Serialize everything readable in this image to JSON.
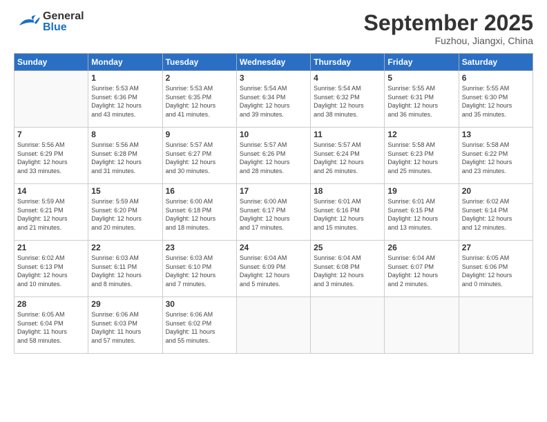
{
  "header": {
    "logo_general": "General",
    "logo_blue": "Blue",
    "month": "September 2025",
    "location": "Fuzhou, Jiangxi, China"
  },
  "weekdays": [
    "Sunday",
    "Monday",
    "Tuesday",
    "Wednesday",
    "Thursday",
    "Friday",
    "Saturday"
  ],
  "weeks": [
    [
      {
        "day": "",
        "info": ""
      },
      {
        "day": "1",
        "info": "Sunrise: 5:53 AM\nSunset: 6:36 PM\nDaylight: 12 hours\nand 43 minutes."
      },
      {
        "day": "2",
        "info": "Sunrise: 5:53 AM\nSunset: 6:35 PM\nDaylight: 12 hours\nand 41 minutes."
      },
      {
        "day": "3",
        "info": "Sunrise: 5:54 AM\nSunset: 6:34 PM\nDaylight: 12 hours\nand 39 minutes."
      },
      {
        "day": "4",
        "info": "Sunrise: 5:54 AM\nSunset: 6:32 PM\nDaylight: 12 hours\nand 38 minutes."
      },
      {
        "day": "5",
        "info": "Sunrise: 5:55 AM\nSunset: 6:31 PM\nDaylight: 12 hours\nand 36 minutes."
      },
      {
        "day": "6",
        "info": "Sunrise: 5:55 AM\nSunset: 6:30 PM\nDaylight: 12 hours\nand 35 minutes."
      }
    ],
    [
      {
        "day": "7",
        "info": "Sunrise: 5:56 AM\nSunset: 6:29 PM\nDaylight: 12 hours\nand 33 minutes."
      },
      {
        "day": "8",
        "info": "Sunrise: 5:56 AM\nSunset: 6:28 PM\nDaylight: 12 hours\nand 31 minutes."
      },
      {
        "day": "9",
        "info": "Sunrise: 5:57 AM\nSunset: 6:27 PM\nDaylight: 12 hours\nand 30 minutes."
      },
      {
        "day": "10",
        "info": "Sunrise: 5:57 AM\nSunset: 6:26 PM\nDaylight: 12 hours\nand 28 minutes."
      },
      {
        "day": "11",
        "info": "Sunrise: 5:57 AM\nSunset: 6:24 PM\nDaylight: 12 hours\nand 26 minutes."
      },
      {
        "day": "12",
        "info": "Sunrise: 5:58 AM\nSunset: 6:23 PM\nDaylight: 12 hours\nand 25 minutes."
      },
      {
        "day": "13",
        "info": "Sunrise: 5:58 AM\nSunset: 6:22 PM\nDaylight: 12 hours\nand 23 minutes."
      }
    ],
    [
      {
        "day": "14",
        "info": "Sunrise: 5:59 AM\nSunset: 6:21 PM\nDaylight: 12 hours\nand 21 minutes."
      },
      {
        "day": "15",
        "info": "Sunrise: 5:59 AM\nSunset: 6:20 PM\nDaylight: 12 hours\nand 20 minutes."
      },
      {
        "day": "16",
        "info": "Sunrise: 6:00 AM\nSunset: 6:18 PM\nDaylight: 12 hours\nand 18 minutes."
      },
      {
        "day": "17",
        "info": "Sunrise: 6:00 AM\nSunset: 6:17 PM\nDaylight: 12 hours\nand 17 minutes."
      },
      {
        "day": "18",
        "info": "Sunrise: 6:01 AM\nSunset: 6:16 PM\nDaylight: 12 hours\nand 15 minutes."
      },
      {
        "day": "19",
        "info": "Sunrise: 6:01 AM\nSunset: 6:15 PM\nDaylight: 12 hours\nand 13 minutes."
      },
      {
        "day": "20",
        "info": "Sunrise: 6:02 AM\nSunset: 6:14 PM\nDaylight: 12 hours\nand 12 minutes."
      }
    ],
    [
      {
        "day": "21",
        "info": "Sunrise: 6:02 AM\nSunset: 6:13 PM\nDaylight: 12 hours\nand 10 minutes."
      },
      {
        "day": "22",
        "info": "Sunrise: 6:03 AM\nSunset: 6:11 PM\nDaylight: 12 hours\nand 8 minutes."
      },
      {
        "day": "23",
        "info": "Sunrise: 6:03 AM\nSunset: 6:10 PM\nDaylight: 12 hours\nand 7 minutes."
      },
      {
        "day": "24",
        "info": "Sunrise: 6:04 AM\nSunset: 6:09 PM\nDaylight: 12 hours\nand 5 minutes."
      },
      {
        "day": "25",
        "info": "Sunrise: 6:04 AM\nSunset: 6:08 PM\nDaylight: 12 hours\nand 3 minutes."
      },
      {
        "day": "26",
        "info": "Sunrise: 6:04 AM\nSunset: 6:07 PM\nDaylight: 12 hours\nand 2 minutes."
      },
      {
        "day": "27",
        "info": "Sunrise: 6:05 AM\nSunset: 6:06 PM\nDaylight: 12 hours\nand 0 minutes."
      }
    ],
    [
      {
        "day": "28",
        "info": "Sunrise: 6:05 AM\nSunset: 6:04 PM\nDaylight: 11 hours\nand 58 minutes."
      },
      {
        "day": "29",
        "info": "Sunrise: 6:06 AM\nSunset: 6:03 PM\nDaylight: 11 hours\nand 57 minutes."
      },
      {
        "day": "30",
        "info": "Sunrise: 6:06 AM\nSunset: 6:02 PM\nDaylight: 11 hours\nand 55 minutes."
      },
      {
        "day": "",
        "info": ""
      },
      {
        "day": "",
        "info": ""
      },
      {
        "day": "",
        "info": ""
      },
      {
        "day": "",
        "info": ""
      }
    ]
  ]
}
